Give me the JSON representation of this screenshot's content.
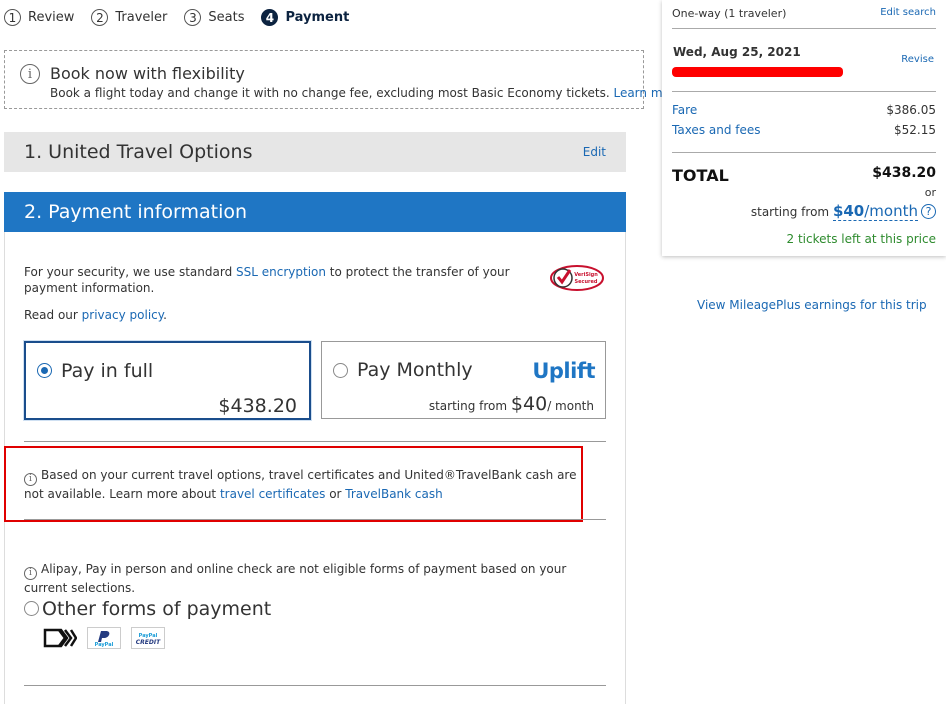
{
  "steps": [
    {
      "num": "1",
      "label": "Review"
    },
    {
      "num": "2",
      "label": "Traveler"
    },
    {
      "num": "3",
      "label": "Seats"
    },
    {
      "num": "4",
      "label": "Payment"
    }
  ],
  "flex_banner": {
    "title": "Book now with flexibility",
    "description": "Book a flight today and change it with no change fee, excluding most Basic Economy tickets.",
    "learn_more": "Learn more"
  },
  "section1": {
    "title": "1. United Travel Options",
    "edit": "Edit"
  },
  "section2": {
    "title": "2. Payment information"
  },
  "security": {
    "prefix": "For your security, we use standard ",
    "link": "SSL encryption",
    "suffix": " to protect the transfer of your payment information.",
    "read_prefix": "Read our ",
    "privacy_link": "privacy policy",
    "read_suffix": "."
  },
  "norton_badge": {
    "line1": "VeriSign",
    "line2": "Secured"
  },
  "pay_full": {
    "title": "Pay in full",
    "amount": "$438.20"
  },
  "pay_monthly": {
    "title": "Pay Monthly",
    "brand": "Uplift",
    "starting_from": "starting from",
    "amount": "$40",
    "per": "/ month"
  },
  "certificates": {
    "text1": "Based on your current travel options, travel certificates and United®TravelBank cash are not available. Learn more about ",
    "link1": "travel certificates",
    "or": " or ",
    "link2": "TravelBank cash"
  },
  "alipay": {
    "text": "Alipay, Pay in person and online check are not eligible forms of payment based on your current selections."
  },
  "other_payment": {
    "label": "Other forms of payment",
    "icons": [
      "card-brand-icon",
      "paypal-icon",
      "paypal-credit-icon"
    ]
  },
  "paypal_icon_text": {
    "paypal": "PayPal",
    "credit_top": "PayPal",
    "credit_bottom": "CREDIT"
  },
  "summary": {
    "trip_type": "One-way (1 traveler)",
    "edit_search": "Edit search",
    "date": "Wed, Aug 25, 2021",
    "revise": "Revise",
    "fare_label": "Fare",
    "fare_value": "$386.05",
    "taxes_label": "Taxes and fees",
    "taxes_value": "$52.15",
    "total_label": "TOTAL",
    "total_value": "$438.20",
    "or": "or",
    "starting_from": "starting from",
    "monthly": "$40",
    "per_month": "/month",
    "tickets_left": "2 tickets left at this price"
  },
  "mileage_link": "View MileagePlus earnings for this trip",
  "colors": {
    "brand_blue": "#1f76c4",
    "link_blue": "#1a68b3",
    "highlight_red": "#e00000",
    "navy": "#0c2340"
  }
}
